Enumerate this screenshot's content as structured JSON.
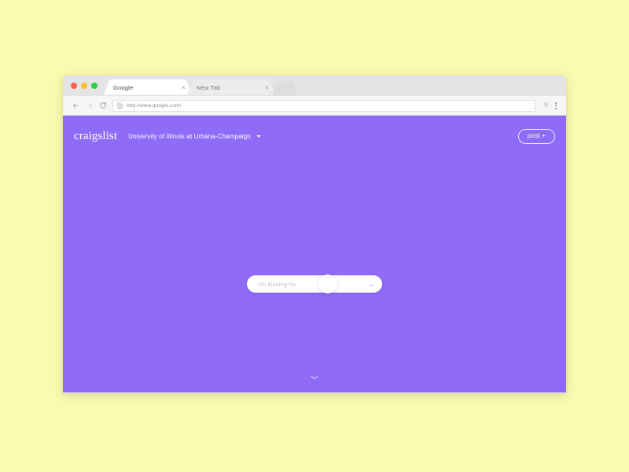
{
  "desktop": {
    "background_color": "#fbfbb0"
  },
  "browser": {
    "window_controls": {
      "close_label": "close",
      "minimize_label": "minimize",
      "maximize_label": "maximize"
    },
    "tabs": [
      {
        "title": "Google",
        "close_label": "×",
        "active": true
      },
      {
        "title": "New Tab",
        "close_label": "×",
        "active": false
      }
    ],
    "new_tab_button_label": "",
    "toolbar": {
      "back_icon": "←",
      "forward_icon": "→",
      "reload_icon": "⟳",
      "url": "http://www.google.com/",
      "bookmark_icon": "★",
      "menu_icon": "more-vertical"
    }
  },
  "site": {
    "brand": "craigslist",
    "location": "University of Illinois at Urbana-Champaign",
    "location_caret_icon": "chevron-down",
    "post_button_label": "post +",
    "accent_color": "#8f6bf7",
    "search": {
      "placeholder": "I'm looking for",
      "value": "",
      "submit_icon": "→"
    },
    "scroll_hint_icon": "⌄"
  }
}
